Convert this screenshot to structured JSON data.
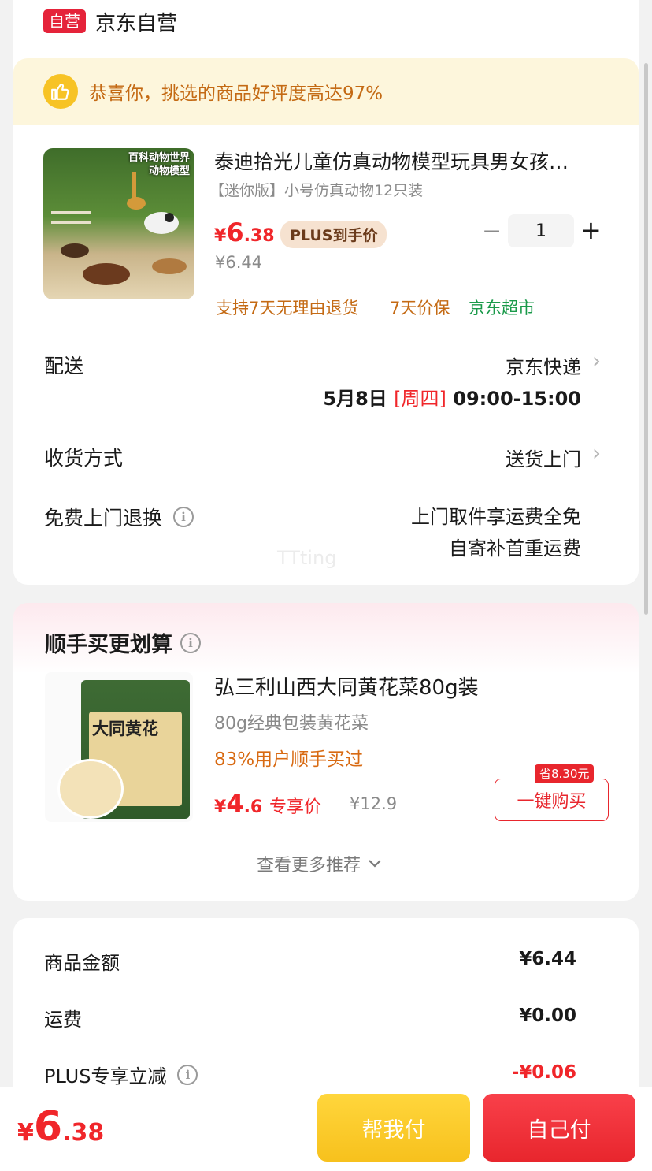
{
  "store": {
    "badge": "自营",
    "name": "京东自营"
  },
  "praise": {
    "text": "恭喜你，挑选的商品好评度高达97%"
  },
  "product": {
    "image_tag_line1": "百科动物世界",
    "image_tag_line2": "动物模型",
    "title": "泰迪拾光儿童仿真动物模型玩具男女孩…",
    "spec": "【迷你版】小号仿真动物12只装",
    "price_symbol": "¥",
    "price_int": "6",
    "price_dec": ".38",
    "plus_tag": "PLUS到手价",
    "old_price": "¥6.44",
    "qty_minus": "−",
    "qty": "1",
    "qty_plus": "+",
    "services": [
      "支持7天无理由退货",
      "7天价保",
      "京东超市"
    ]
  },
  "delivery": {
    "label": "配送",
    "carrier": "京东快递",
    "date": "5月8日",
    "weekday": "[周四]",
    "time": "09:00-15:00"
  },
  "receive": {
    "label": "收货方式",
    "value": "送货上门"
  },
  "return": {
    "label": "免费上门退换",
    "line1": "上门取件享运费全免",
    "line2": "自寄补首重运费"
  },
  "watermark": "TTting",
  "recommend": {
    "title": "顺手买更划算",
    "bag_label": "大同黄花",
    "name": "弘三利山西大同黄花菜80g装",
    "sub": "80g经典包装黄花菜",
    "hint": "83%用户顺手买过",
    "price_symbol": "¥",
    "price_int": "4",
    "price_dec": ".6",
    "price_label": "专享价",
    "old_price": "¥12.9",
    "save_tag": "省8.30元",
    "buy_label": "一键购买",
    "more_label": "查看更多推荐"
  },
  "summary": {
    "goods_label": "商品金额",
    "goods_value": "¥6.44",
    "freight_label": "运费",
    "freight_value": "¥0.00",
    "plus_label": "PLUS专享立减",
    "plus_value": "-¥0.06"
  },
  "bottom": {
    "total_symbol": "¥",
    "total_int": "6",
    "total_dec": ".38",
    "help_pay": "帮我付",
    "self_pay": "自己付"
  },
  "colors": {
    "accent_red": "#f0262a",
    "plus_gold": "#f7c11d",
    "service_orange": "#c46a14",
    "service_green": "#1a9a4a"
  }
}
